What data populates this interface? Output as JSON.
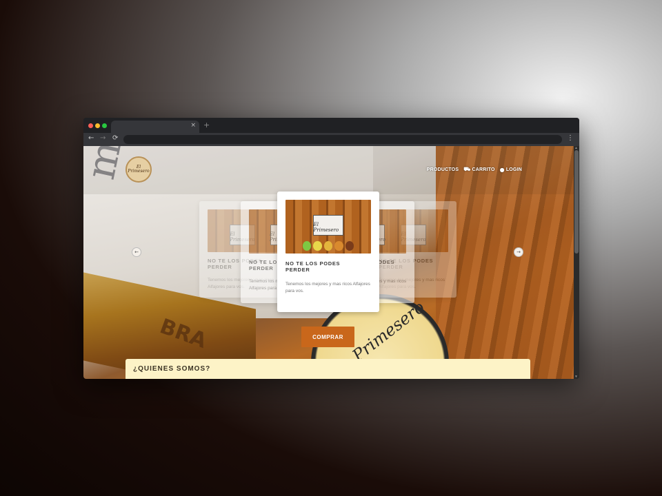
{
  "browser": {
    "tab_close": "×",
    "new_tab": "+",
    "nav_back": "←",
    "nav_forward": "→",
    "nav_reload": "⟳",
    "menu": "⋮"
  },
  "site": {
    "logo_text": "El Primesero",
    "nav": [
      {
        "icon": "",
        "label": "PRODUCTOS"
      },
      {
        "icon": "🛒",
        "label": "CARRITO"
      },
      {
        "icon": "👤",
        "label": "LOGIN"
      }
    ],
    "hero_box_text": "mesero",
    "hero_label_text": "Primesero",
    "hero_bottle_text": "BRA"
  },
  "carousel": {
    "prev": "←",
    "next": "→",
    "cards": [
      {
        "title": "NO TE LOS PODES PERDER",
        "desc": "Tenemos los mejores y mas ricos Alfajores para vos.",
        "sign": "El Primesero"
      },
      {
        "title": "NO TE LOS PODES PERDER",
        "desc": "Tenemos los mejores y mas ricos Alfajores para vos.",
        "sign": "El Primesero"
      },
      {
        "title": "NO TE LOS PODES PERDER",
        "desc": "Tenemos los mejores y mas ricos Alfajores para vos.",
        "sign": "El Primesero"
      },
      {
        "title": "NO TE LOS PODES PERDER",
        "desc": "Tenemos los mejores y mas ricos Alfajores para vos.",
        "sign": "El Primesero"
      },
      {
        "title": "NO TE LOS PODES PERDER",
        "desc": "Tenemos los mejores y mas ricos Alfajores para vos.",
        "sign": "El Primesero"
      }
    ],
    "buy_label": "COMPRAR"
  },
  "about": {
    "title": "¿QUIENES SOMOS?"
  },
  "colors": {
    "accent": "#c9671b",
    "panel": "#fdf3c7"
  },
  "icons": {
    "cart": "cart-icon",
    "user": "user-icon"
  }
}
